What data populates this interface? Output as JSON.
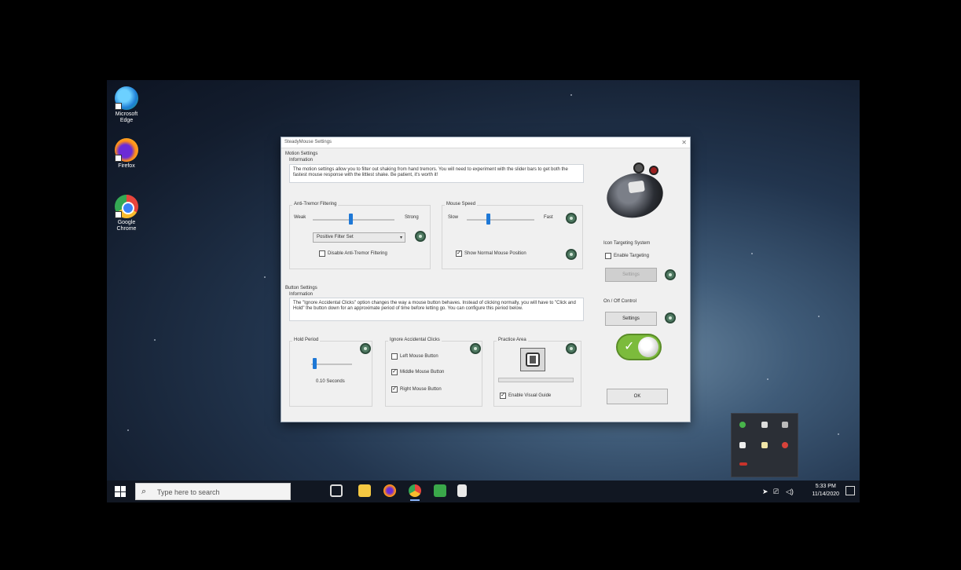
{
  "desktop": {
    "icons": [
      {
        "label": "Microsoft Edge"
      },
      {
        "label": "Firefox"
      },
      {
        "label": "Google Chrome"
      }
    ]
  },
  "dialog": {
    "title": "SteadyMouse Settings",
    "motion": {
      "heading": "Motion Settings",
      "info_label": "Information",
      "info_text": "The motion settings allow you to filter out shaking from hand tremors. You will need to experiment with the slider bars to get both the fastest mouse response with the littlest shake. Be patient, it's worth it!",
      "anti_tremor_label": "Anti-Tremor Filtering",
      "weak_label": "Weak",
      "strong_label": "Strong",
      "anti_tremor_level": 0.45,
      "filter_select": "Positive Filter Set",
      "disable_filter_label": "Disable Anti-Tremor Filtering",
      "disable_filter_checked": false,
      "mouse_speed_label": "Mouse Speed",
      "slow_label": "Slow",
      "fast_label": "Fast",
      "mouse_speed_level": 0.3,
      "show_normal_label": "Show Normal Mouse Position",
      "show_normal_checked": true
    },
    "button": {
      "heading": "Button Settings",
      "info_label": "Information",
      "info_text": "The \"Ignore Accidental Clicks\" option changes the way a mouse button behaves. Instead of clicking normally, you will have to \"Click and Hold\" the button down for an approximate period of time before letting go. You can configure this period below.",
      "hold_period_label": "Hold Period",
      "hold_period_level": 0.05,
      "hold_value": "0.10 Seconds",
      "ignore_label": "Ignore Accidental Clicks",
      "left_label": "Left Mouse Button",
      "left_checked": false,
      "middle_label": "Middle Mouse Button",
      "middle_checked": true,
      "right_label": "Right Mouse Button",
      "right_checked": true,
      "practice_label": "Practice Area",
      "visual_guide_label": "Enable Visual Guide",
      "visual_guide_checked": true
    },
    "side": {
      "icon_targeting_label": "Icon Targeting System",
      "enable_targeting_label": "Enable Targeting",
      "enable_targeting_checked": false,
      "targeting_settings_label": "Settings",
      "onoff_label": "On / Off Control",
      "onoff_settings_label": "Settings",
      "ok_label": "OK"
    }
  },
  "taskbar": {
    "search_placeholder": "Type here to search",
    "time": "5:33 PM",
    "date": "11/14/2020"
  },
  "colors": {
    "accent": "#1e78d6",
    "help": "#4f7a62",
    "toggle_on": "#7cbb3c"
  }
}
